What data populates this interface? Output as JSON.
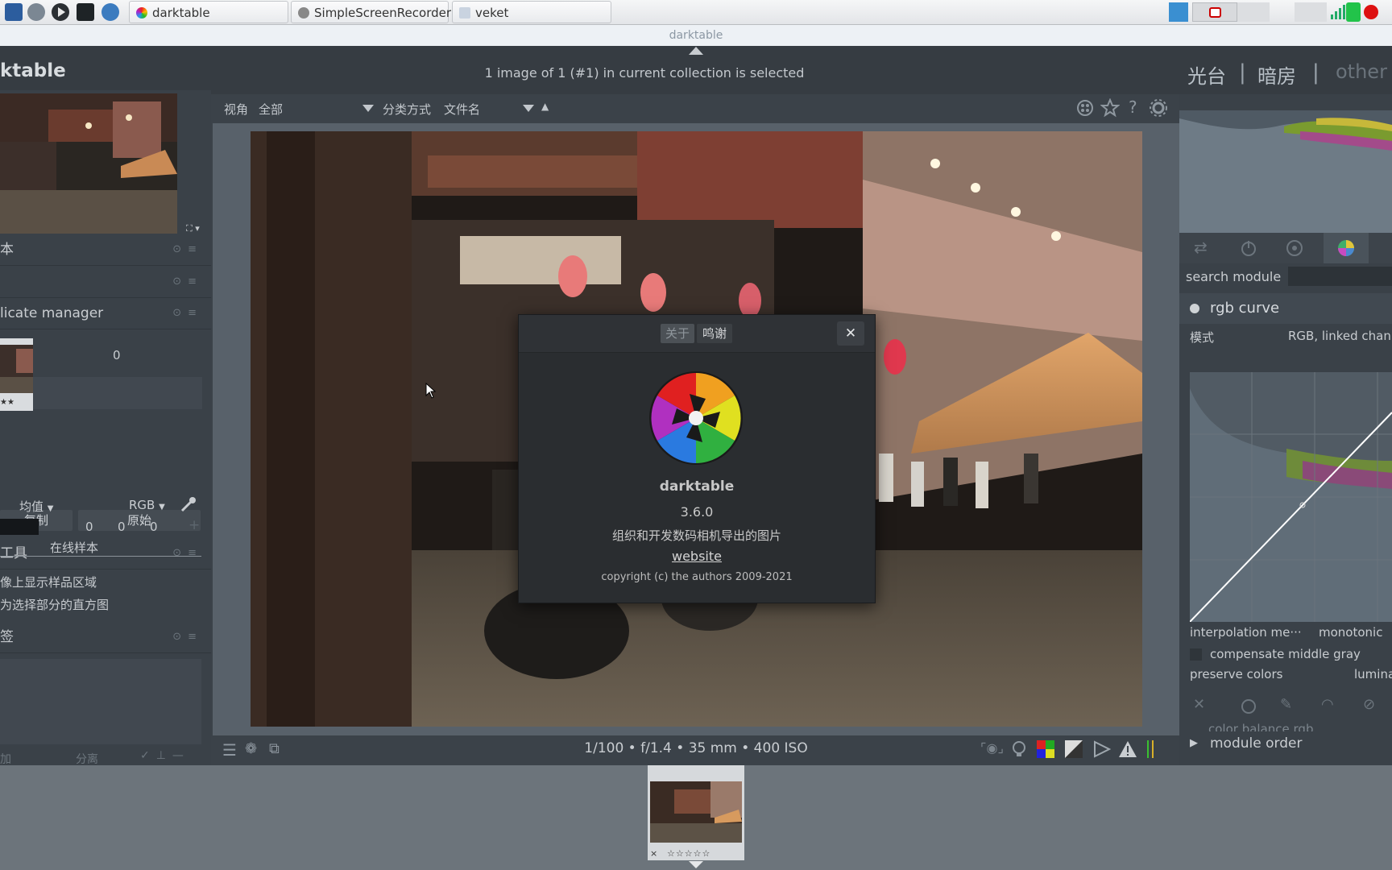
{
  "taskbar": {
    "launchers": [
      "system-monitor-icon",
      "settings-icon",
      "media-play-icon",
      "terminal-icon",
      "browser-globe-icon"
    ],
    "tabs": [
      {
        "label": "darktable",
        "icon": "darktable-icon"
      },
      {
        "label": "SimpleScreenRecorder",
        "icon": "recorder-icon"
      },
      {
        "label": "veket",
        "icon": "folder-icon"
      }
    ]
  },
  "window": {
    "title": "darktable"
  },
  "header": {
    "app_name": "ktable",
    "status": "1 image of 1 (#1) in current collection is selected",
    "views": {
      "lighttable": "光台",
      "darkroom": "暗房",
      "other": "other",
      "sep": "|"
    }
  },
  "toolbar": {
    "view_label": "视角",
    "view_value": "全部",
    "sort_label": "分类方式",
    "sort_value": "文件名",
    "sort_dir": "▲"
  },
  "left_panel": {
    "section_basic": "本",
    "duplicate_manager": "licate manager",
    "dup_number": "0",
    "dup_stars": "★★",
    "btn_duplicate": "复制",
    "btn_original": "原始",
    "section_tools": "工具",
    "mode_value": "均值",
    "color_space": "RGB",
    "sample_values": [
      "0",
      "0",
      "0"
    ],
    "live_sample": "在线样本",
    "opt_show_area": "像上显示样品区域",
    "opt_histogram": "为选择部分的直方图",
    "section_tags": "签",
    "bottom_add": "加",
    "bottom_detach": "分离"
  },
  "bottom_bar": {
    "exif": "1/100 • f/1.4 • 35 mm • 400 ISO"
  },
  "right_panel": {
    "search_label": "search module",
    "module_title": "rgb curve",
    "mode_label": "模式",
    "mode_value": "RGB, linked chan",
    "interp_label": "interpolation me···",
    "interp_value": "monotonic",
    "compensate_label": "compensate middle gray",
    "preserve_label": "preserve colors",
    "preserve_value": "lumina",
    "next_module": "color balance rgb",
    "module_order": "module order"
  },
  "filmstrip": {
    "stars": "☆☆☆☆☆",
    "reject": "×"
  },
  "about_dialog": {
    "tab_about": "关于",
    "tab_credits": "鸣谢",
    "close": "✕",
    "app_name": "darktable",
    "version": "3.6.0",
    "description": "组织和开发数码相机导出的图片",
    "website": "website",
    "copyright": "copyright (c) the authors 2009-2021"
  },
  "colors": {
    "panel_bg": "#3a4148",
    "dialog_bg": "#2a2d30",
    "header_bg": "#363c42",
    "canvas_bg": "#58616a"
  }
}
